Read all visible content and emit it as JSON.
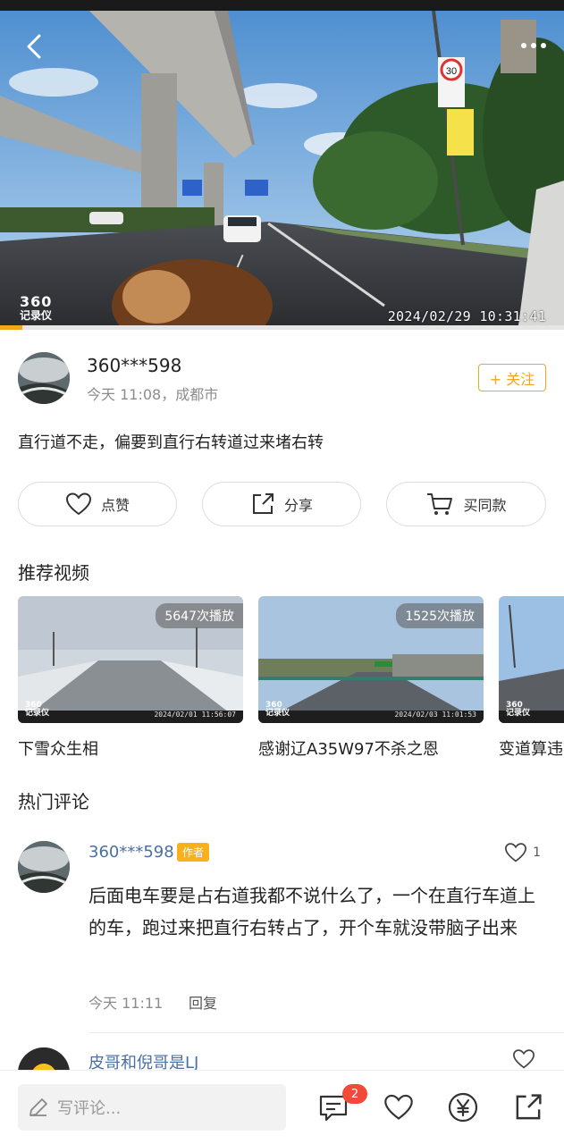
{
  "video": {
    "brand_number": "360",
    "brand_text": "记录仪",
    "timestamp": "2024/02/29  10:31:41",
    "progress": 0.04,
    "sign_limit": "30",
    "accent_color": "#f2a818"
  },
  "author": {
    "name": "360***598",
    "meta": "今天 11:08，成都市",
    "follow_label": "+ 关注"
  },
  "post": {
    "text": "直行道不走，偏要到直行右转道过来堵右转"
  },
  "actions": {
    "like_label": "点赞",
    "share_label": "分享",
    "buy_label": "买同款"
  },
  "recommended": {
    "title": "推荐视频",
    "items": [
      {
        "count": "5647次播放",
        "title": "下雪众生相",
        "logo": "360\n记录仪",
        "time": "2024/02/01  11:56:07"
      },
      {
        "count": "1525次播放",
        "title": "感谢辽A35W97不杀之恩",
        "logo": "360\n记录仪",
        "time": "2024/02/03  11:01:53"
      },
      {
        "count": "",
        "title": "变道算违",
        "logo": "360\n记录仪",
        "time": ""
      }
    ]
  },
  "comments": {
    "title": "热门评论",
    "items": [
      {
        "user": "360***598",
        "tag": "作者",
        "likes": "1",
        "text": "后面电车要是占右道我都不说什么了，一个在直行车道上的车，跑过来把直行右转占了，开个车就没带脑子出来",
        "time": "今天 11:11",
        "reply_label": "回复"
      },
      {
        "user": "皮哥和倪哥是LJ",
        "likes": ""
      }
    ]
  },
  "bottom_bar": {
    "input_placeholder": "写评论...",
    "comment_badge": "2",
    "icons": [
      "pencil-icon",
      "comment-icon",
      "heart-icon",
      "yuan-icon",
      "share-icon"
    ]
  }
}
